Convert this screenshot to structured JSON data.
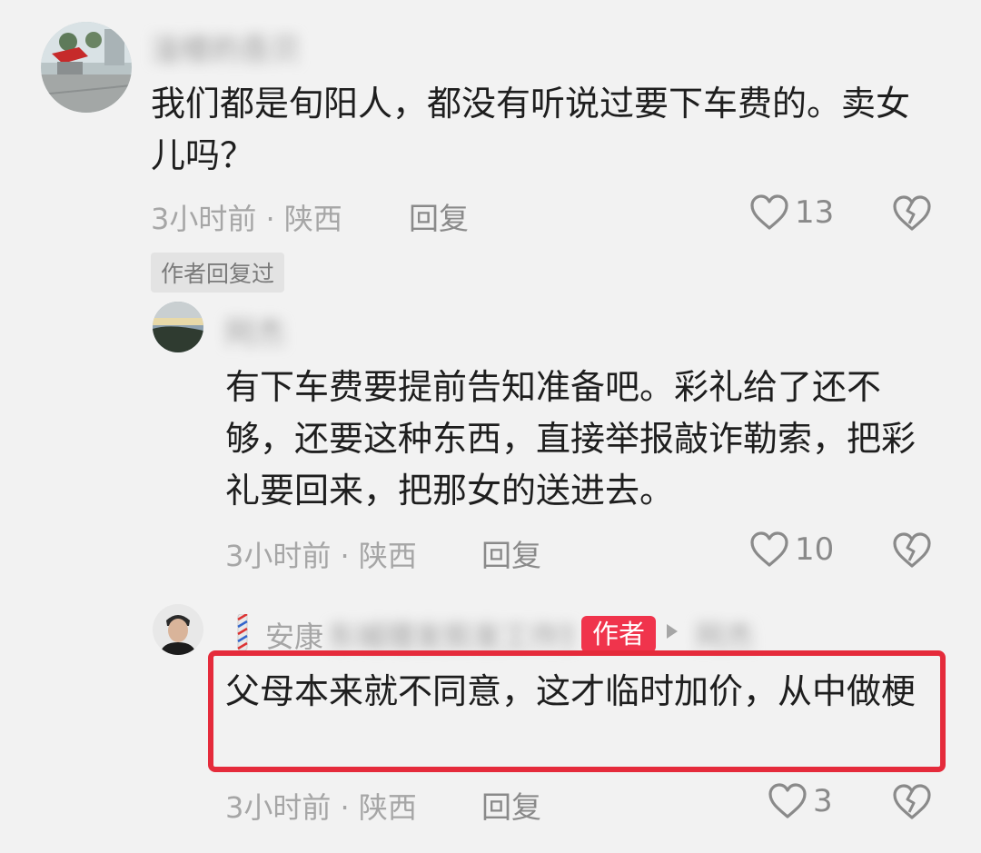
{
  "comment1": {
    "username": "淦楼的吾贝",
    "text": "我们都是旬阳人，都没有听说过要下车费的。卖女儿吗？",
    "meta": "3小时前 · 陕西",
    "reply_label": "回复",
    "like_count": "13",
    "author_replied_tag": "作者回复过"
  },
  "reply1": {
    "username": "阿杰",
    "text": "有下车费要提前告知准备吧。彩礼给了还不够，还要这种东西，直接举报敲诈勒索，把彩礼要回来，把那女的送进去。",
    "meta": "3小时前 · 陕西",
    "reply_label": "回复",
    "like_count": "10"
  },
  "reply2": {
    "username_visible": "安康",
    "username_hidden": "东城理发剪发工作室",
    "author_badge": "作者",
    "reply_to": "阿杰",
    "text": "父母本来就不同意，这才临时加价，从中做梗",
    "meta": "3小时前 · 陕西",
    "reply_label": "回复",
    "like_count": "3"
  },
  "colors": {
    "background": "#f2f2f2",
    "highlight": "#e52b3b",
    "author_badge": "#f0344c",
    "meta_text": "#a6a6a6"
  }
}
